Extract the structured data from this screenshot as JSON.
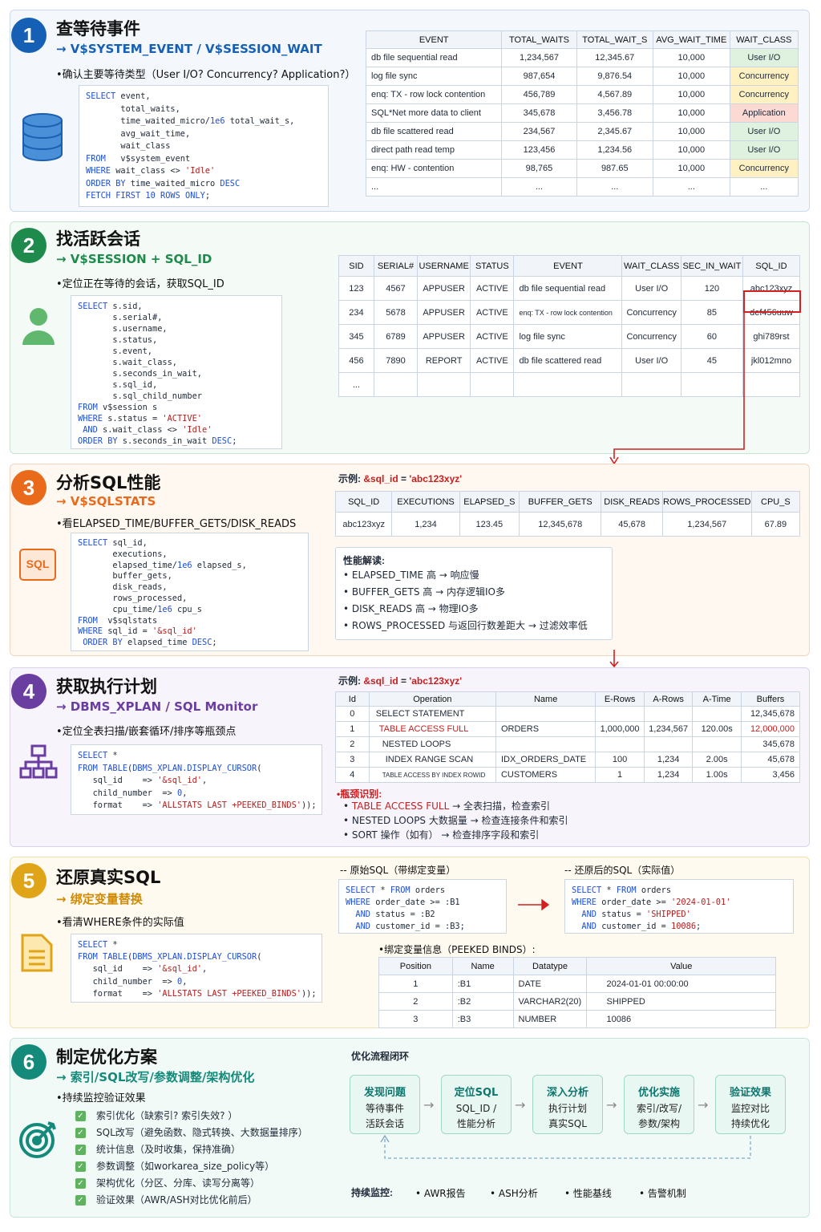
{
  "s1": {
    "num": "1",
    "title": "查等待事件",
    "sub": "→ V$SYSTEM_EVENT / V$SESSION_WAIT",
    "desc": "•确认主要等待类型（User I/O? Concurrency? Application?）",
    "headers": [
      "EVENT",
      "TOTAL_WAITS",
      "TOTAL_WAIT_S",
      "AVG_WAIT_TIME",
      "WAIT_CLASS"
    ],
    "rows": [
      [
        "db file sequential read",
        "1,234,567",
        "12,345.67",
        "10,000",
        "User I/O"
      ],
      [
        "log file sync",
        "987,654",
        "9,876.54",
        "10,000",
        "Concurrency"
      ],
      [
        "enq: TX - row lock contention",
        "456,789",
        "4,567.89",
        "10,000",
        "Concurrency"
      ],
      [
        "SQL*Net more data to client",
        "345,678",
        "3,456.78",
        "10,000",
        "Application"
      ],
      [
        "db file scattered read",
        "234,567",
        "2,345.67",
        "10,000",
        "User I/O"
      ],
      [
        "direct path read temp",
        "123,456",
        "1,234.56",
        "10,000",
        "User I/O"
      ],
      [
        "enq: HW - contention",
        "98,765",
        "987.65",
        "10,000",
        "Concurrency"
      ],
      [
        "...",
        "...",
        "...",
        "...",
        "..."
      ]
    ]
  },
  "s2": {
    "num": "2",
    "title": "找活跃会话",
    "sub": "→ V$SESSION + SQL_ID",
    "desc": "•定位正在等待的会话，获取SQL_ID",
    "headers": [
      "SID",
      "SERIAL#",
      "USERNAME",
      "STATUS",
      "EVENT",
      "WAIT_CLASS",
      "SEC_IN_WAIT",
      "SQL_ID"
    ],
    "rows": [
      [
        "123",
        "4567",
        "APPUSER",
        "ACTIVE",
        "db file sequential read",
        "User I/O",
        "120",
        "abc123xyz"
      ],
      [
        "234",
        "5678",
        "APPUSER",
        "ACTIVE",
        "enq: TX - row lock contention",
        "Concurrency",
        "85",
        "def456uuw"
      ],
      [
        "345",
        "6789",
        "APPUSER",
        "ACTIVE",
        "log file sync",
        "Concurrency",
        "60",
        "ghi789rst"
      ],
      [
        "456",
        "7890",
        "REPORT",
        "ACTIVE",
        "db file scattered read",
        "User I/O",
        "45",
        "jkl012mno"
      ],
      [
        "...",
        "",
        "",
        "",
        "",
        "",
        "",
        ""
      ]
    ]
  },
  "s3": {
    "num": "3",
    "title": "分析SQL性能",
    "sub": "→ V$SQLSTATS",
    "desc": "•看ELAPSED_TIME/BUFFER_GETS/DISK_READS",
    "icon_label": "SQL",
    "example_prefix": "示例:",
    "example_var": "&sql_id",
    "example_eq": " = ",
    "example_val": "'abc123xyz'",
    "headers": [
      "SQL_ID",
      "EXECUTIONS",
      "ELAPSED_S",
      "BUFFER_GETS",
      "DISK_READS",
      "ROWS_PROCESSED",
      "CPU_S"
    ],
    "row": [
      "abc123xyz",
      "1,234",
      "123.45",
      "12,345,678",
      "45,678",
      "1,234,567",
      "67.89"
    ],
    "notes_title": "性能解读:",
    "notes": [
      "ELAPSED_TIME  高  →  响应慢",
      "BUFFER_GETS   高  →  内存逻辑IO多",
      "DISK_READS  高  →  物理IO多",
      "ROWS_PROCESSED 与返回行数差距大 → 过滤效率低"
    ]
  },
  "s4": {
    "num": "4",
    "title": "获取执行计划",
    "sub": "→ DBMS_XPLAN / SQL Monitor",
    "desc": "•定位全表扫描/嵌套循环/排序等瓶颈点",
    "example_prefix": "示例:",
    "example_var": "&sql_id",
    "example_eq": " = ",
    "example_val": "'abc123xyz'",
    "headers": [
      "Id",
      "Operation",
      "Name",
      "E-Rows",
      "A-Rows",
      "A-Time",
      "Buffers"
    ],
    "rows": [
      [
        "0",
        "SELECT STATEMENT",
        "",
        "",
        "",
        "",
        "12,345,678"
      ],
      [
        "1",
        "TABLE ACCESS FULL",
        "ORDERS",
        "1,000,000",
        "1,234,567",
        "120.00s",
        "12,000,000"
      ],
      [
        "2",
        "NESTED LOOPS",
        "",
        "",
        "",
        "",
        "345,678"
      ],
      [
        "3",
        "INDEX RANGE SCAN",
        "IDX_ORDERS_DATE",
        "100",
        "1,234",
        "2.00s",
        "45,678"
      ],
      [
        "4",
        "TABLE ACCESS BY INDEX ROWID",
        "CUSTOMERS",
        "1",
        "1,234",
        "1.00s",
        "3,456"
      ]
    ],
    "bottleneck_title": "•瓶颈识别:",
    "bottlenecks": [
      {
        "hl": "TABLE ACCESS FULL",
        "rest": " →  全表扫描，检查索引"
      },
      {
        "hl": "",
        "rest": "NESTED LOOPS 大数据量  →  检查连接条件和索引"
      },
      {
        "hl": "",
        "rest": "SORT 操作（如有）  →  检查排序字段和索引"
      }
    ]
  },
  "s5": {
    "num": "5",
    "title": "还原真实SQL",
    "sub": "→ 绑定变量替换",
    "desc": "•看清WHERE条件的实际值",
    "orig_label": "-- 原始SQL（带绑定变量）",
    "restored_label": "-- 还原后的SQL（实际值）",
    "binds_title": "•绑定变量信息（PEEKED BINDS）:",
    "headers": [
      "Position",
      "Name",
      "Datatype",
      "Value"
    ],
    "rows": [
      [
        "1",
        ":B1",
        "DATE",
        "2024-01-01 00:00:00"
      ],
      [
        "2",
        ":B2",
        "VARCHAR2(20)",
        "SHIPPED"
      ],
      [
        "3",
        ":B3",
        "NUMBER",
        "10086"
      ]
    ]
  },
  "s6": {
    "num": "6",
    "title": "制定优化方案",
    "sub": "→ 索引/SQL改写/参数调整/架构优化",
    "desc": "•持续监控验证效果",
    "checks": [
      "索引优化（缺索引? 索引失效? ）",
      "SQL改写（避免函数、隐式转换、大数据量排序）",
      "统计信息（及时收集，保持准确）",
      "参数调整（如workarea_size_policy等）",
      "架构优化（分区、分库、读写分离等）",
      "验证效果（AWR/ASH对比优化前后）"
    ],
    "flow_title": "优化流程闭环",
    "flow": [
      {
        "t": "发现问题",
        "d1": "等待事件",
        "d2": "活跃会话"
      },
      {
        "t": "定位SQL",
        "d1": "SQL_ID /",
        "d2": "性能分析"
      },
      {
        "t": "深入分析",
        "d1": "执行计划",
        "d2": "真实SQL"
      },
      {
        "t": "优化实施",
        "d1": "索引/改写/",
        "d2": "参数/架构"
      },
      {
        "t": "验证效果",
        "d1": "监控对比",
        "d2": "持续优化"
      }
    ],
    "monitor_label": "持续监控:",
    "monitor": [
      "• AWR报告",
      "• ASH分析",
      "• 性能基线",
      "• 告警机制"
    ]
  },
  "colors": {
    "s1": "#1560b5",
    "s2": "#1e8a4c",
    "s3": "#ea6a1c",
    "s4": "#6a3da0",
    "s5": "#e0a418",
    "s6": "#138a7a",
    "userio": "#dff2df",
    "concurrency": "#fff1c2",
    "application": "#fcd9d2"
  }
}
